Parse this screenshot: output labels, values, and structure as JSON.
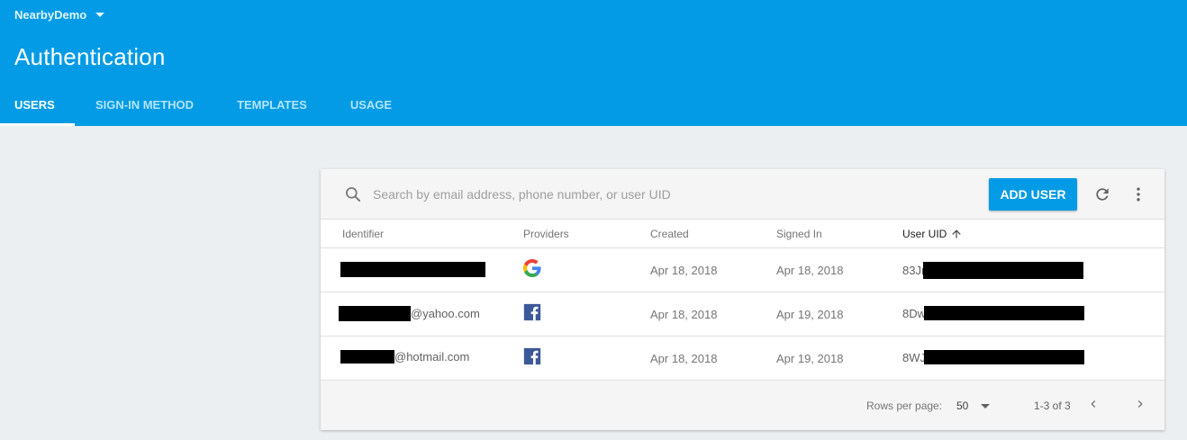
{
  "header": {
    "project_name": "NearbyDemo",
    "title": "Authentication",
    "tabs": [
      {
        "label": "USERS",
        "active": true
      },
      {
        "label": "SIGN-IN METHOD",
        "active": false
      },
      {
        "label": "TEMPLATES",
        "active": false
      },
      {
        "label": "USAGE",
        "active": false
      }
    ],
    "background_color": "#039be5"
  },
  "toolbar": {
    "search_placeholder": "Search by email address, phone number, or user UID",
    "search_value": "",
    "add_user_label": "ADD USER",
    "add_user_color": "#039be5",
    "refresh_icon": "refresh-icon",
    "more_icon": "more-vert-icon"
  },
  "table": {
    "columns": [
      "Identifier",
      "Providers",
      "Created",
      "Signed In",
      "User UID"
    ],
    "sorted_column": "User UID",
    "sort_direction": "ascending",
    "rows": [
      {
        "identifier_suffix": "",
        "provider": "google-icon",
        "created": "Apr 18, 2018",
        "signed_in": "Apr 18, 2018",
        "uid_prefix": "83Jr"
      },
      {
        "identifier_suffix": "@yahoo.com",
        "provider": "facebook-icon",
        "created": "Apr 18, 2018",
        "signed_in": "Apr 19, 2018",
        "uid_prefix": "8Dw"
      },
      {
        "identifier_suffix": "@hotmail.com",
        "provider": "facebook-icon",
        "created": "Apr 18, 2018",
        "signed_in": "Apr 19, 2018",
        "uid_prefix": "8WJ"
      }
    ]
  },
  "footer": {
    "rows_per_page_label": "Rows per page:",
    "rows_per_page_value": "50",
    "range_text": "1-3 of 3"
  }
}
